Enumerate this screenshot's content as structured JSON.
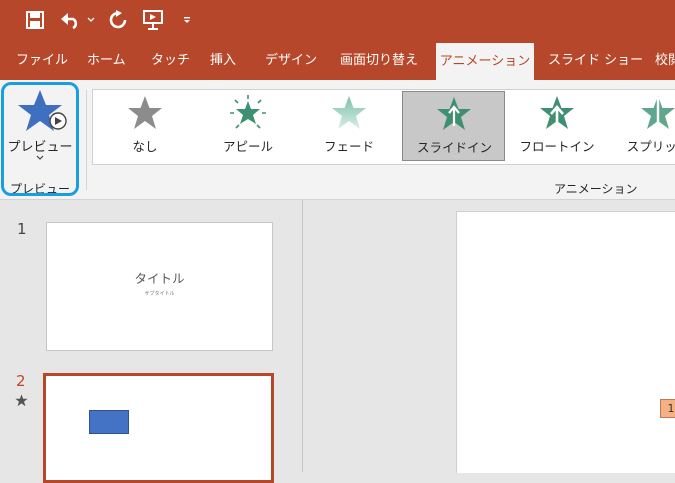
{
  "quick_access": {
    "items": [
      "save-icon",
      "undo-icon",
      "redo-icon",
      "start-from-beginning-icon",
      "customize-icon"
    ]
  },
  "tabs": [
    {
      "label": "ファイル"
    },
    {
      "label": "ホーム"
    },
    {
      "label": "タッチ"
    },
    {
      "label": "挿入"
    },
    {
      "label": "デザイン"
    },
    {
      "label": "画面切り替え"
    },
    {
      "label": "アニメーション",
      "active": true
    },
    {
      "label": "スライド ショー"
    },
    {
      "label": "校閲"
    }
  ],
  "preview_group": {
    "button_label": "プレビュー",
    "group_label": "プレビュー"
  },
  "animation_group": {
    "group_label": "アニメーション",
    "items": [
      {
        "label": "なし",
        "icon": "star-gray-icon"
      },
      {
        "label": "アピール",
        "icon": "star-burst-icon"
      },
      {
        "label": "フェード",
        "icon": "star-fade-icon"
      },
      {
        "label": "スライドイン",
        "icon": "star-slide-in-icon",
        "selected": true
      },
      {
        "label": "フロートイン",
        "icon": "star-float-in-icon"
      },
      {
        "label": "スプリット",
        "icon": "star-split-icon"
      }
    ]
  },
  "slides": [
    {
      "number": "1",
      "title": "タイトル",
      "subtitle": "サブタイトル"
    },
    {
      "number": "2",
      "has_animation": true
    }
  ],
  "colors": {
    "accent": "#b7472a",
    "highlight": "#1a9ee0",
    "shape": "#4472c4",
    "animation_tag": "#f4b183"
  },
  "editor": {
    "animation_tag_text": "1"
  }
}
